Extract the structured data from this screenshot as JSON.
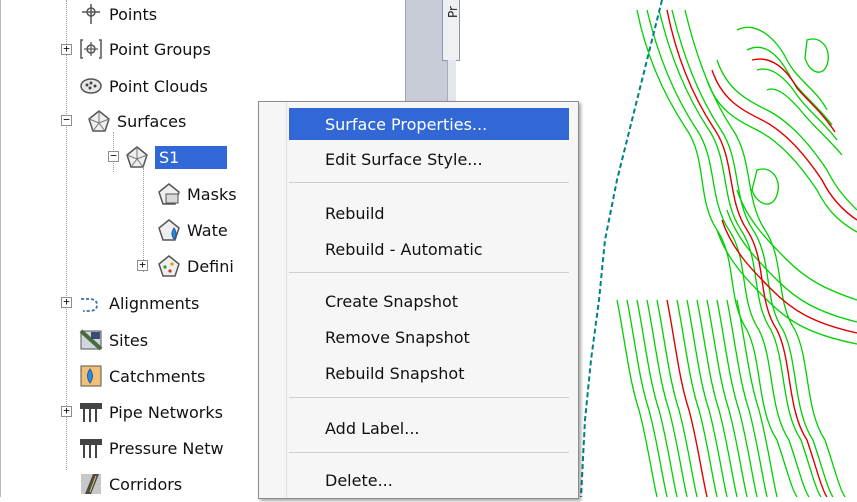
{
  "tree": {
    "points": "Points",
    "point_groups": "Point Groups",
    "point_clouds": "Point Clouds",
    "surfaces": "Surfaces",
    "s1": "S1",
    "masks": "Masks",
    "watersheds": "Wate",
    "definition": "Defini",
    "alignments": "Alignments",
    "sites": "Sites",
    "catchments": "Catchments",
    "pipe_networks": "Pipe Networks",
    "pressure_networks": "Pressure Netw",
    "corridors": "Corridors"
  },
  "side_tab": {
    "label": "Pr"
  },
  "context_menu": {
    "items": [
      "Surface Properties...",
      "Edit Surface Style...",
      "Rebuild",
      "Rebuild - Automatic",
      "Create Snapshot",
      "Remove Snapshot",
      "Rebuild Snapshot",
      "Add Label...",
      "Delete..."
    ]
  },
  "colors": {
    "selection": "#3168d5",
    "contour_minor": "#00d000",
    "contour_major": "#e00000",
    "boundary": "#008080"
  }
}
